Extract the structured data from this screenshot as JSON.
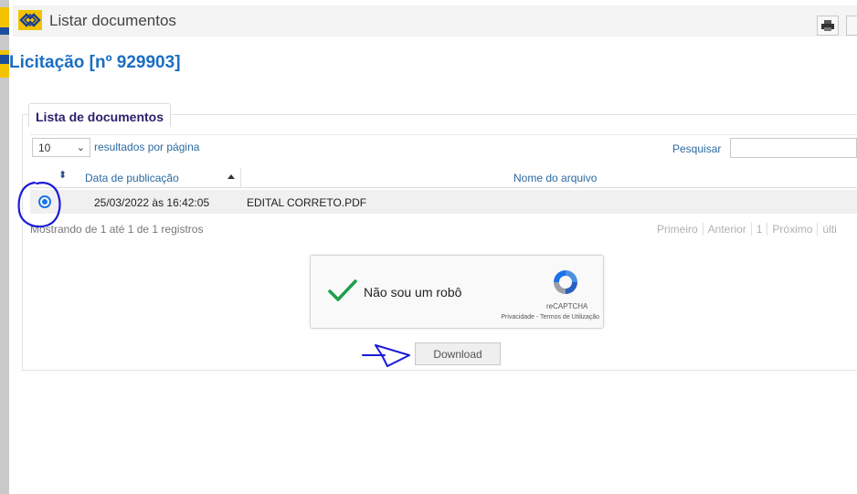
{
  "window": {
    "title": "Listar documentos"
  },
  "page": {
    "title": "Licitação [nº 929903]"
  },
  "panel": {
    "tab_label": "Lista de documentos"
  },
  "controls": {
    "page_length": "10",
    "page_length_label": "resultados por página",
    "search_label": "Pesquisar",
    "search_value": ""
  },
  "table": {
    "columns": [
      "",
      "Data de publicação",
      "Nome do arquivo"
    ],
    "rows": [
      {
        "selected": true,
        "date": "25/03/2022 às 16:42:05",
        "file": "EDITAL CORRETO.PDF"
      }
    ],
    "info": "Mostrando de 1 até 1 de 1 registros",
    "pagination": [
      "Primeiro",
      "Anterior",
      "1",
      "Próximo",
      "últi"
    ]
  },
  "recaptcha": {
    "label": "Não sou um robô",
    "brand": "reCAPTCHA",
    "terms": "Privacidade - Termos de Utilização"
  },
  "download": {
    "label": "Download"
  },
  "colors": {
    "title_blue": "#1b6ec2",
    "link_blue": "#2c6aa0",
    "tab_text": "#2b1f6b",
    "radio_blue": "#1a73e8",
    "annotation_blue": "#1a1ad8",
    "brand_yellow": "#f2c200"
  }
}
